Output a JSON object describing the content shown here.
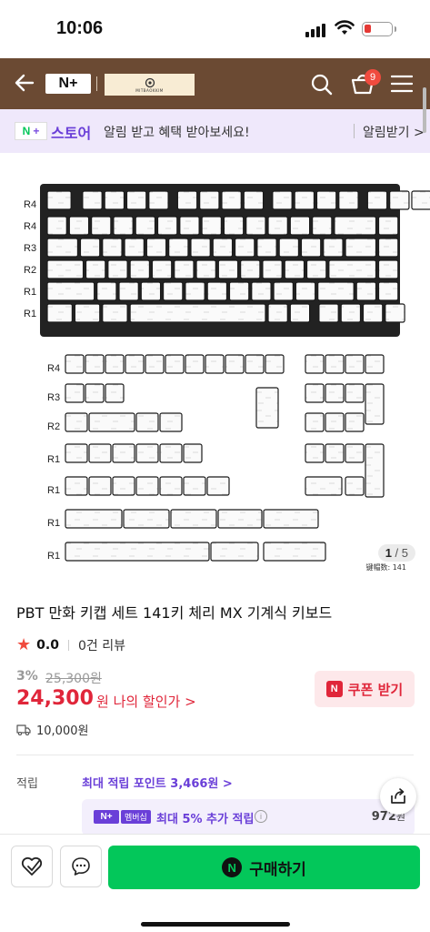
{
  "status_bar": {
    "time": "10:06"
  },
  "header": {
    "np_logo": "N+",
    "brand_logo_text": "MITBAOKKIM",
    "cart_count": "9"
  },
  "store_banner": {
    "logo": "N+",
    "title": "스토어",
    "message": "알림 받고 혜택 받아보세요!",
    "alert_button": "알림받기 >"
  },
  "image": {
    "counter_current": "1",
    "counter_total": "5",
    "caption": "键帽数: 141",
    "keyboard_row_labels": [
      "R4",
      "R4",
      "R3",
      "R2",
      "R1",
      "R1"
    ],
    "extra_row_labels": [
      "R4",
      "R3",
      "R2",
      "R1",
      "R1",
      "R1",
      "R1"
    ]
  },
  "product": {
    "title": "PBT 만화 키캡 세트 141키 체리 MX 기계식 키보드",
    "rating": "0.0",
    "review_count": "0건 리뷰",
    "discount": "3%",
    "original_price": "25,300원",
    "sale_price": "24,300",
    "sale_suffix": "원 나의 할인가 >",
    "coupon_label": "쿠폰 받기",
    "coupon_icon": "N",
    "shipping_fee": "10,000원"
  },
  "points": {
    "label": "적립",
    "max": "최대 적립 포인트 3,466원 >",
    "member_logo": "N+",
    "member_tag": "멤버십",
    "member_text": "최대 5% 추가 적립",
    "member_amount": "972",
    "member_unit": "원"
  },
  "bottom_bar": {
    "buy_label": "구매하기",
    "buy_icon": "N"
  },
  "colors": {
    "header_bg": "#6b4a33",
    "store_accent": "#6a3fd8",
    "price_red": "#e0263a",
    "buy_green": "#03c75a"
  }
}
